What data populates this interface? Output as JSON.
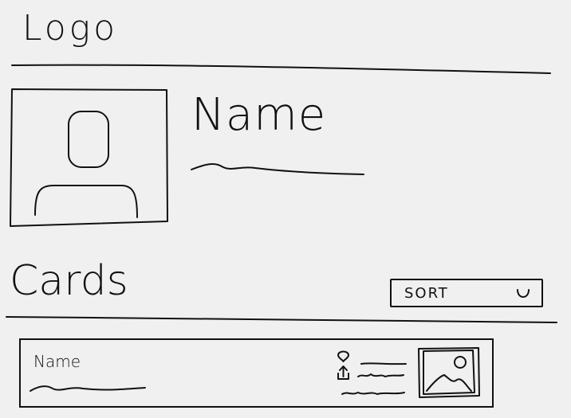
{
  "header": {
    "logo_text": "Logo"
  },
  "profile": {
    "name": "Name",
    "avatar_icon": "user-avatar-icon"
  },
  "cards_section": {
    "title": "Cards",
    "sort": {
      "label": "SORT",
      "icon": "chevron-down-icon"
    },
    "cards": [
      {
        "name": "Name",
        "thumbnail_icon": "image-icon",
        "meta_icons": [
          "location-pin-icon",
          "upload-icon"
        ]
      }
    ]
  }
}
